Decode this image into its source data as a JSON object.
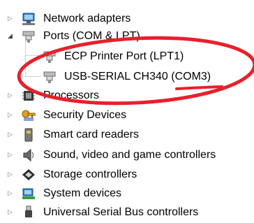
{
  "device_tree": {
    "items": [
      {
        "label": "Network adapters",
        "expander": "▷",
        "icon": "network-adapter-icon"
      },
      {
        "label": "Ports (COM & LPT)",
        "expander": "◢",
        "icon": "port-connector-icon"
      },
      {
        "label": "ECP Printer Port (LPT1)",
        "icon": "port-connector-icon"
      },
      {
        "label": "USB-SERIAL CH340 (COM3)",
        "icon": "port-connector-icon"
      },
      {
        "label": "Processors",
        "expander": "▷",
        "icon": "processor-chip-icon"
      },
      {
        "label": "Security Devices",
        "expander": "▷",
        "icon": "security-key-icon"
      },
      {
        "label": "Smart card readers",
        "expander": "▷",
        "icon": "smart-card-reader-icon"
      },
      {
        "label": "Sound, video and game controllers",
        "expander": "▷",
        "icon": "speaker-icon"
      },
      {
        "label": "Storage controllers",
        "expander": "▷",
        "icon": "storage-controller-icon"
      },
      {
        "label": "System devices",
        "expander": "▷",
        "icon": "system-devices-icon"
      },
      {
        "label": "Universal Serial Bus controllers",
        "expander": "▷",
        "icon": "usb-plug-icon"
      }
    ]
  },
  "annotation": {
    "ellipse_color": "#e8202a",
    "underline_color": "#e8202a"
  }
}
